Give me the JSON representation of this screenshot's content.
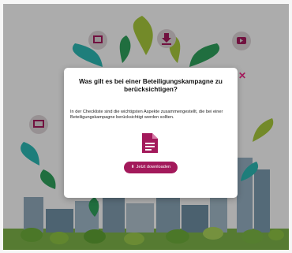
{
  "modal": {
    "title": "Was gilt es bei einer Beteiligungskampagne zu berücksichtigen?",
    "description": "In der Checkliste sind die wichtigsten Aspekte zusammengestellt, die bei einer Beteiligungskampagne berücksichtigt werden sollten.",
    "download_label": "Jetzt downloaden",
    "download_arrow": "⬇",
    "close_symbol": "✕",
    "icon": "document-icon"
  },
  "background_icons": [
    "image-icon",
    "download-icon",
    "video-icon",
    "presentation-icon"
  ],
  "colors": {
    "accent": "#a3195b",
    "overlay": "rgba(0,0,0,0.30)",
    "leaf_green": "#2e9e5b",
    "leaf_lime": "#a5c63b",
    "leaf_teal": "#2bb5b0",
    "icon_circle": "#d9d0d3"
  }
}
